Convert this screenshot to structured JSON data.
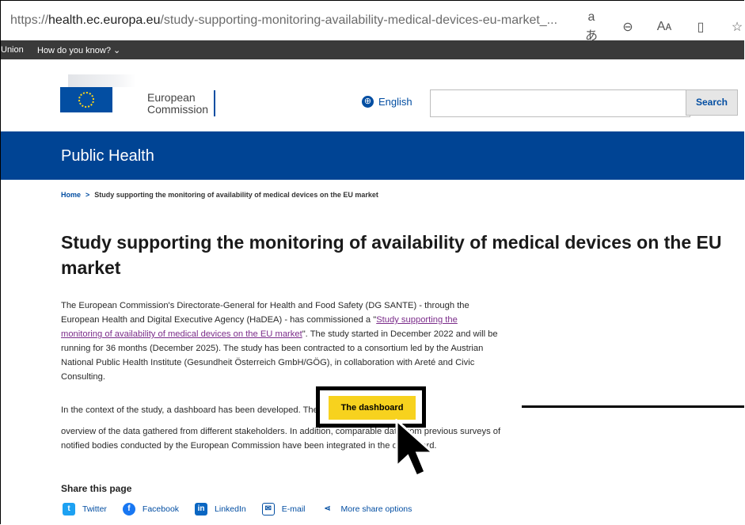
{
  "browser": {
    "url_prefix": "https://",
    "url_host": "health.ec.europa.eu",
    "url_path": "/study-supporting-monitoring-availability-medical-devices-eu-market_...",
    "icons": [
      "translate-icon",
      "zoom-out-icon",
      "read-aloud-icon",
      "immersive-reader-icon",
      "favorite-icon"
    ],
    "icon_glyphs": [
      "aあ",
      "⊖",
      "Aᴀ",
      "▯",
      "☆"
    ]
  },
  "topstrip": {
    "left_text": "Union",
    "menu": "How do you know? ⌄"
  },
  "header": {
    "logo_line1": "European",
    "logo_line2": "Commission",
    "language": "English",
    "search_placeholder": "",
    "search_button": "Search"
  },
  "band": {
    "title": "Public Health"
  },
  "breadcrumb": {
    "home": "Home",
    "separator": ">",
    "current": "Study supporting the monitoring of availability of medical devices on the EU market"
  },
  "page": {
    "title": "Study supporting the monitoring of availability of medical devices on the EU market",
    "p1_a": "The European Commission's Directorate-General for Health and Food Safety (DG SANTE) - through the European Health and Digital Executive Agency (HaDEA) - has commissioned a \"",
    "p1_link": "Study supporting the monitoring of availability of medical devices on the EU market",
    "p1_b": "\". The study started in December 2022 and will be running for 36 months (December 2025). The study has been contracted to a consortium led by the Austrian National Public Health Institute (Gesundheit Österreich GmbH/GÖG), in collaboration with Areté and Civic Consulting.",
    "p2": "In the context of the study, a dashboard has been developed. The dashboard presents an",
    "p3": "overview of the data gathered from different stakeholders. In addition, comparable data from previous surveys of notified bodies conducted by the European Commission have been integrated in the dashboard.",
    "dashboard_button": "The dashboard"
  },
  "share": {
    "heading": "Share this page",
    "items": [
      {
        "label": "Twitter",
        "icon": "twitter-icon",
        "color": "#1da1f2"
      },
      {
        "label": "Facebook",
        "icon": "facebook-icon",
        "color": "#1877f2"
      },
      {
        "label": "LinkedIn",
        "icon": "linkedin-icon",
        "color": "#0a66c2"
      },
      {
        "label": "E-mail",
        "icon": "email-icon",
        "color": "#034ea2"
      },
      {
        "label": "More share options",
        "icon": "share-icon",
        "color": "#034ea2"
      }
    ]
  },
  "colors": {
    "brand_blue": "#004494",
    "link_blue": "#034ea2",
    "dashboard_yellow": "#f7d21e"
  }
}
